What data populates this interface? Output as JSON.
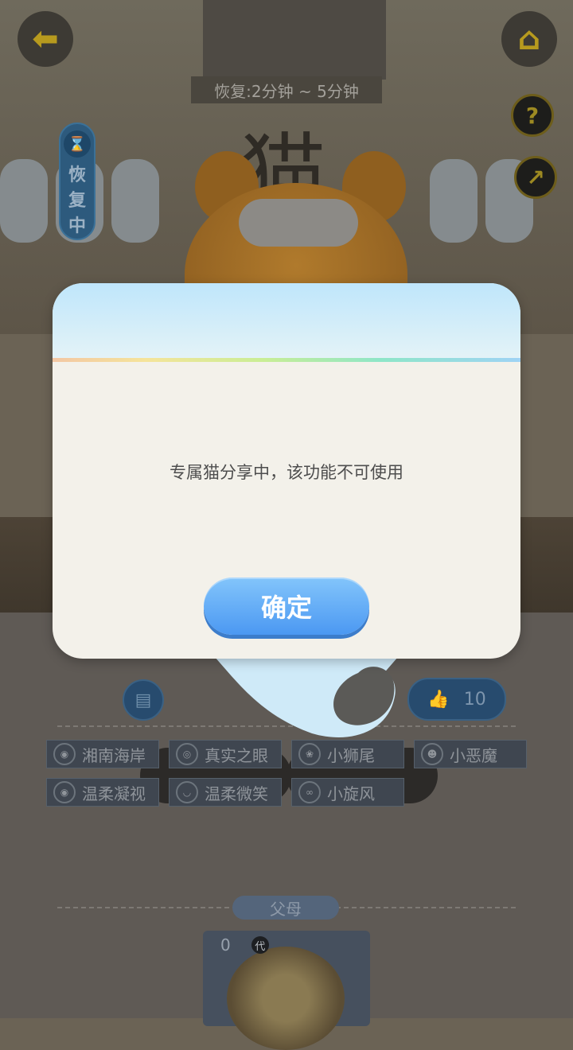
{
  "header": {
    "recover_time": "恢复:2分钟 ~ 5分钟",
    "recover_status": [
      "恢",
      "复",
      "中"
    ]
  },
  "dialog": {
    "message": "专属猫分享中，该功能不可使用",
    "confirm_label": "确定"
  },
  "likes": {
    "count": "10"
  },
  "traits": [
    "湘南海岸",
    "真实之眼",
    "小狮尾",
    "小恶魔",
    "温柔凝视",
    "温柔微笑",
    "小旋风"
  ],
  "parents": {
    "label": "父母",
    "generation_value": "0",
    "generation_badge": "代"
  },
  "colors": {
    "accent": "#4b98f2",
    "dialog_bg": "#f3f1ea",
    "dialog_header": "#bfe6fb"
  },
  "icons": {
    "back": "back-arrow-icon",
    "home": "home-icon",
    "help": "help-icon",
    "share": "share-icon",
    "hourglass": "hourglass-icon",
    "save": "save-icon",
    "like": "thumbs-up-icon"
  }
}
